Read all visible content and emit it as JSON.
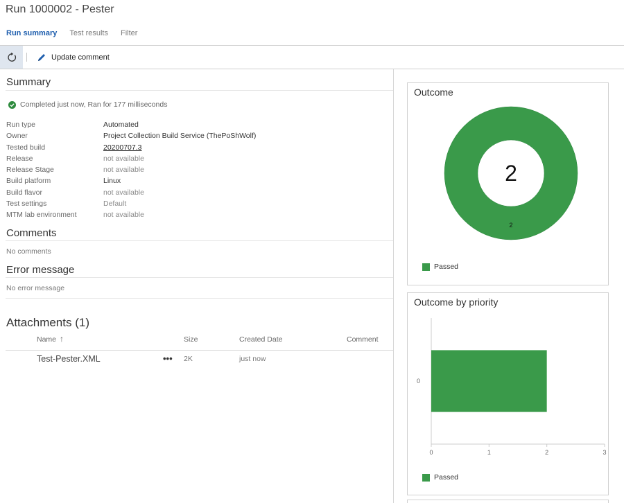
{
  "window": {
    "title": "Run 1000002 - Pester"
  },
  "tabs": [
    {
      "label": "Run summary",
      "active": true
    },
    {
      "label": "Test results",
      "active": false
    },
    {
      "label": "Filter",
      "active": false
    }
  ],
  "toolbar": {
    "refresh_icon": "refresh-icon",
    "update_comment_label": "Update comment",
    "update_comment_icon": "pencil-icon"
  },
  "summary": {
    "heading": "Summary",
    "status_icon": "check-circle-icon",
    "status_text": "Completed just now, Ran for 177 milliseconds",
    "properties": [
      {
        "label": "Run type",
        "value": "Automated"
      },
      {
        "label": "Owner",
        "value": "Project Collection Build Service (ThePoShWolf)"
      },
      {
        "label": "Tested build",
        "value": "20200707.3"
      },
      {
        "label": "Release",
        "value": "not available"
      },
      {
        "label": "Release Stage",
        "value": "not available"
      },
      {
        "label": "Build platform",
        "value": "Linux"
      },
      {
        "label": "Build flavor",
        "value": "not available"
      },
      {
        "label": "Test settings",
        "value": "Default"
      },
      {
        "label": "MTM lab environment",
        "value": "not available"
      }
    ]
  },
  "comments": {
    "heading": "Comments",
    "empty_text": "No comments"
  },
  "error_message": {
    "heading": "Error message",
    "empty_text": "No error message"
  },
  "attachments": {
    "heading": "Attachments (1)",
    "columns": [
      "Name",
      "Size",
      "Created Date",
      "Comment"
    ],
    "sort_icon": "sort-ascending-arrow-icon",
    "sort_glyph": "↑",
    "more_glyph": "•••",
    "rows": [
      {
        "name": "Test-Pester.XML",
        "size": "2K",
        "created": "just now",
        "comment": ""
      }
    ]
  },
  "outcome_card": {
    "title": "Outcome",
    "center_value": "2",
    "slice_label": "2",
    "legend_label": "Passed",
    "color": "#3a9a4a"
  },
  "priority_card": {
    "title": "Outcome by priority",
    "legend_label": "Passed",
    "color": "#3a9a4a"
  },
  "chart_data": [
    {
      "type": "pie",
      "title": "Outcome",
      "categories": [
        "Passed"
      ],
      "values": [
        2
      ],
      "center_label": "2",
      "legend": "bottom-left"
    },
    {
      "type": "bar",
      "title": "Outcome by priority",
      "orientation": "horizontal",
      "categories": [
        "0"
      ],
      "series": [
        {
          "name": "Passed",
          "values": [
            2
          ]
        }
      ],
      "xlim": [
        0,
        3
      ],
      "xticks": [
        "0",
        "1",
        "2",
        "3"
      ],
      "legend": "bottom-left",
      "grid": false
    }
  ]
}
